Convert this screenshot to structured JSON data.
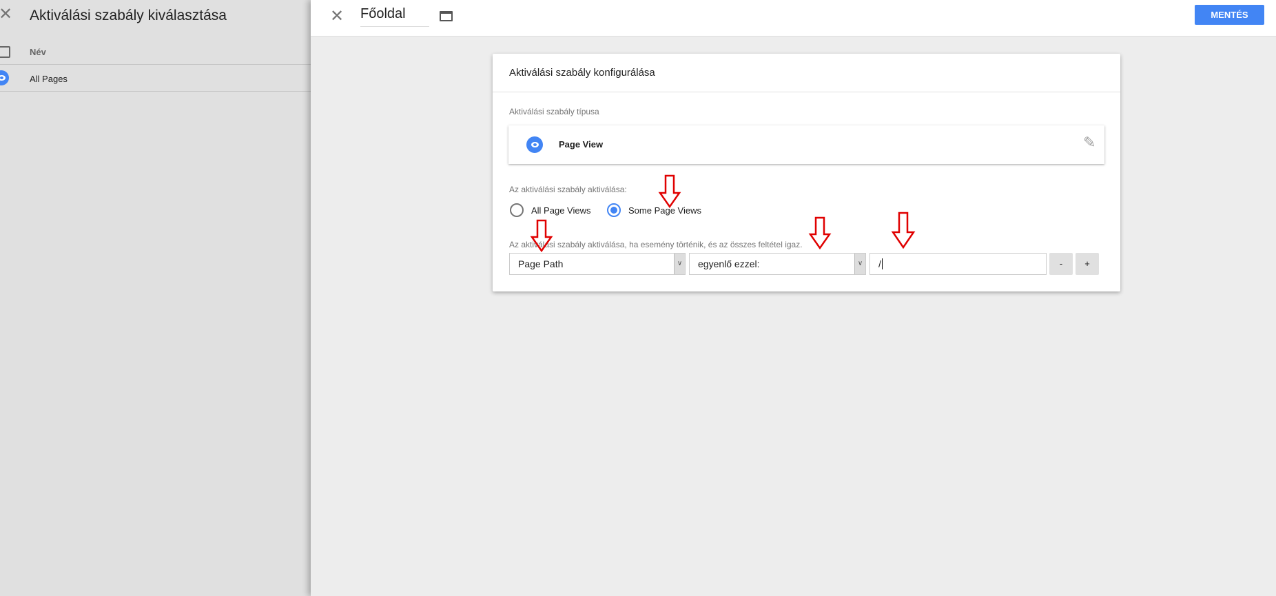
{
  "left_panel": {
    "title": "Aktiválási szabály kiválasztása",
    "column_name": "Név",
    "rows": [
      {
        "name": "All Pages",
        "icon": "eye-icon"
      }
    ]
  },
  "header": {
    "name_value": "Főoldal",
    "save_label": "MENTÉS",
    "accent": "#4285f4"
  },
  "card": {
    "title": "Aktiválási szabály konfigurálása",
    "type_label": "Aktiválási szabály típusa",
    "type_value": "Page View",
    "fire_on_label": "Az aktiválási szabály aktiválása:",
    "radio_options": [
      {
        "label": "All Page Views",
        "selected": false
      },
      {
        "label": "Some Page Views",
        "selected": true
      }
    ],
    "condition_label": "Az aktiválási szabály aktiválása, ha esemény történik, és az összes feltétel igaz.",
    "condition": {
      "variable": "Page Path",
      "operator": "egyenlő ezzel:",
      "value": "/"
    },
    "remove_label": "-",
    "add_label": "+"
  },
  "annotation_color": "#e00000"
}
